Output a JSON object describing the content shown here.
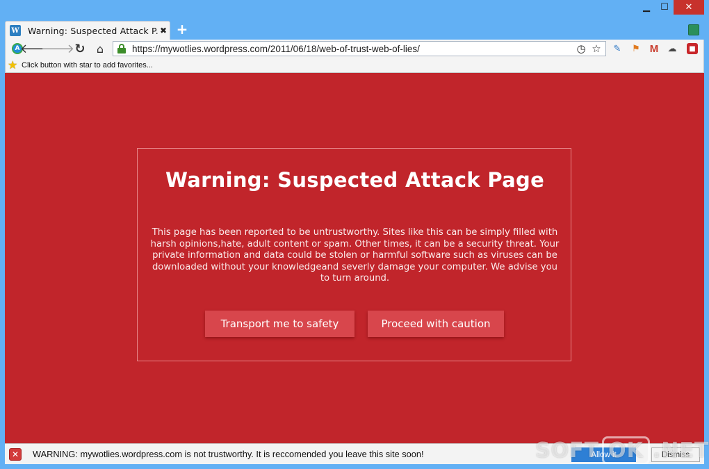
{
  "window": {
    "min_glyph": "▁",
    "max_glyph": "☐",
    "close_glyph": "✕"
  },
  "tab": {
    "favicon_letter": "W",
    "title": "Warning: Suspected Attack P...",
    "close_glyph": "✖"
  },
  "new_tab_glyph": "+",
  "toolbar": {
    "url": "https://mywotlies.wordpress.com/2011/06/18/web-of-trust-web-of-lies/",
    "icons": [
      "account-icon",
      "back-icon",
      "forward-icon",
      "reload-icon",
      "home-icon",
      "lock-icon",
      "speed-dial-icon",
      "star-icon"
    ]
  },
  "extensions": [
    "extension-icon-1",
    "extension-icon-2",
    "gmail-icon",
    "weather-icon",
    "extension-icon-5"
  ],
  "bookmarks": {
    "hint": "Click button with star to add favorites..."
  },
  "warning": {
    "title": "Warning: Suspected Attack Page",
    "body": "This page has been reported to be untrustworthy. Sites like this can be simply filled with harsh opinions,hate, adult content or spam. Other times, it can be a security threat. Your private information and data could be stolen or harmful software such as viruses can be downloaded without your knowledgeand severly damage your computer. We advise you to turn around.",
    "safety_button": "Transport me to safety",
    "proceed_button": "Proceed with caution"
  },
  "notification": {
    "text": "WARNING: mywotlies.wordpress.com is not trustworthy. It is reccomended you leave this site soon!",
    "allow_button": "Allow it",
    "dismiss_button": "Dismiss"
  },
  "watermark": {
    "left": "SOFT",
    "mid": "OK",
    "right": ".NET"
  },
  "colors": {
    "page_bg": "#c1252b",
    "button_bg": "#d8464c",
    "window_frame": "#62b0f4",
    "allow_button": "#2e7fd5"
  }
}
